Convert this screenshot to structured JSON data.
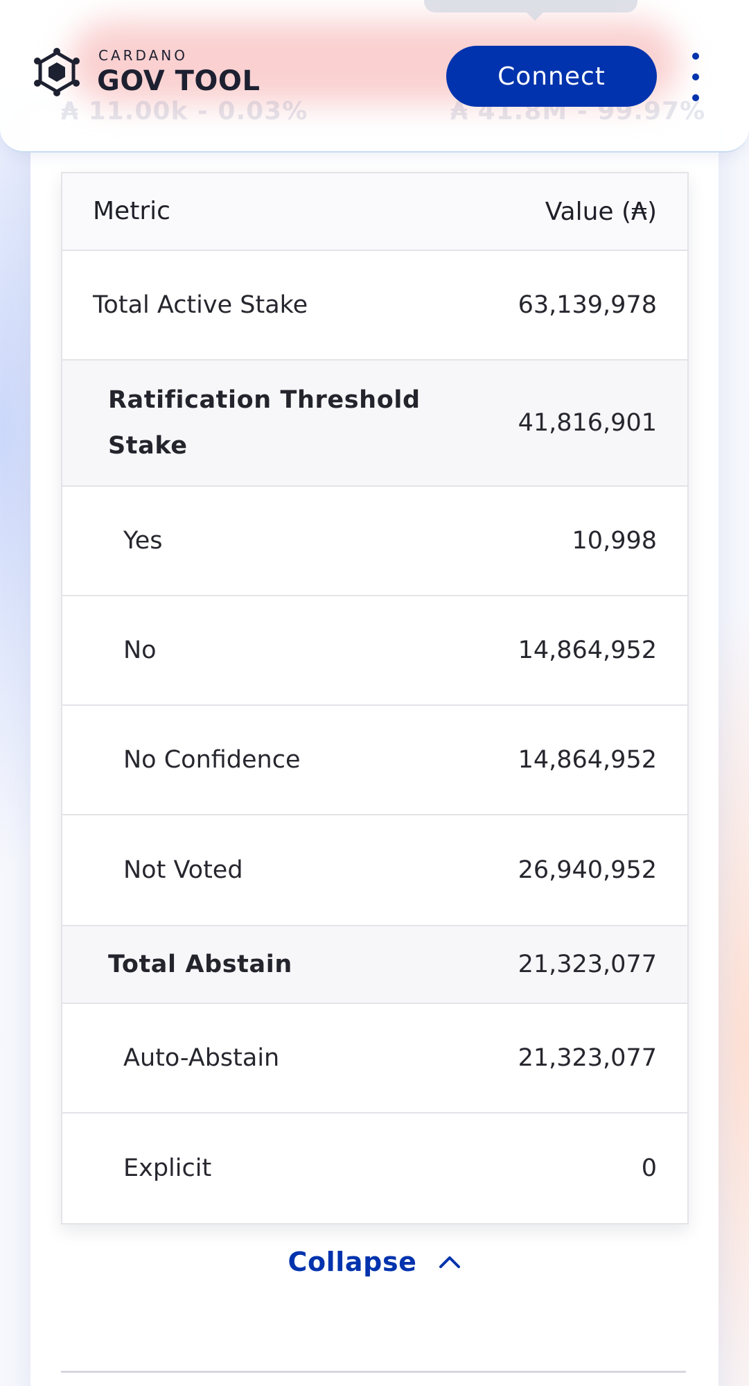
{
  "header": {
    "logo_small": "CARDANO",
    "logo_big": "GOV TOOL",
    "connect_label": "Connect",
    "ghost_left": "₳ 11.00k - 0.03%",
    "ghost_right": "₳ 41.8M - 99.97%"
  },
  "table": {
    "headers": {
      "metric": "Metric",
      "value": "Value (₳)"
    },
    "rows": [
      {
        "label": "Total Active Stake",
        "value": "63,139,978"
      },
      {
        "label": "Ratification Threshold Stake",
        "value": "41,816,901"
      },
      {
        "label": "Yes",
        "value": "10,998"
      },
      {
        "label": "No",
        "value": "14,864,952"
      },
      {
        "label": "No Confidence",
        "value": "14,864,952"
      },
      {
        "label": "Not Voted",
        "value": "26,940,952"
      },
      {
        "label": "Total Abstain",
        "value": "21,323,077"
      },
      {
        "label": "Auto-Abstain",
        "value": "21,323,077"
      },
      {
        "label": "Explicit",
        "value": "0"
      }
    ]
  },
  "collapse_label": "Collapse"
}
